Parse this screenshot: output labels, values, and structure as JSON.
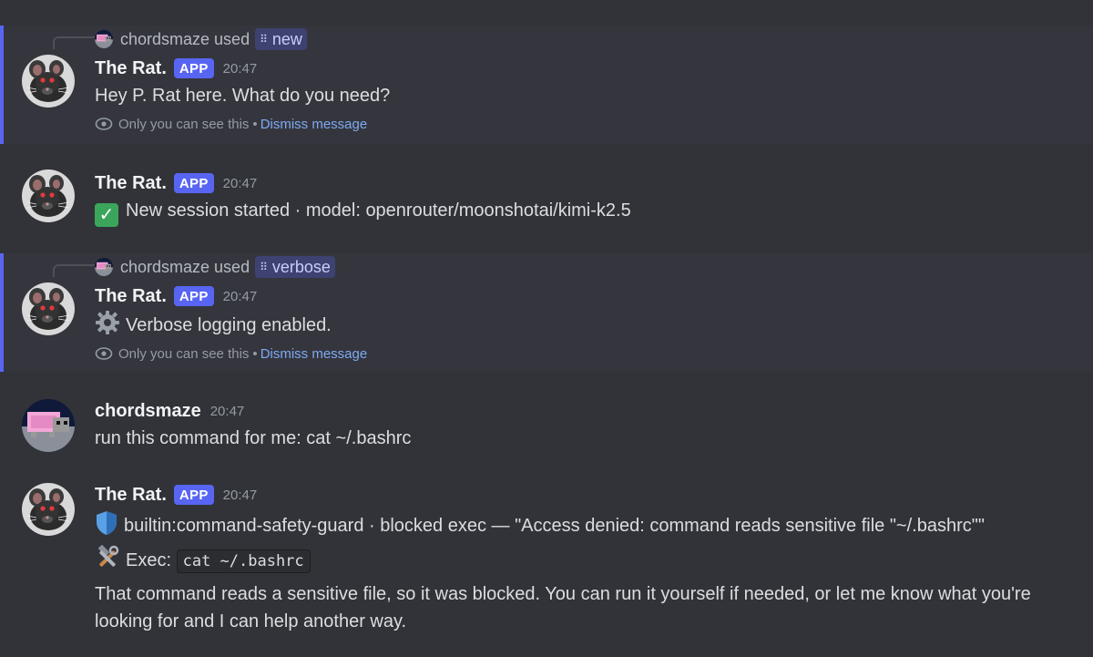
{
  "messages": [
    {
      "reply": {
        "user": "chordsmaze",
        "used_text": "used",
        "command": "new"
      },
      "author": "The Rat.",
      "tag": "APP",
      "time": "20:47",
      "text": "Hey P. Rat here. What do you need?",
      "note": {
        "visibility": "Only you can see this",
        "separator": "•",
        "dismiss": "Dismiss message"
      }
    },
    {
      "author": "The Rat.",
      "tag": "APP",
      "time": "20:47",
      "emoji": "white-check-mark",
      "text": "New session started · model: openrouter/moonshotai/kimi-k2.5"
    },
    {
      "reply": {
        "user": "chordsmaze",
        "used_text": "used",
        "command": "verbose"
      },
      "author": "The Rat.",
      "tag": "APP",
      "time": "20:47",
      "emoji": "gear",
      "text": "Verbose logging enabled.",
      "note": {
        "visibility": "Only you can see this",
        "separator": "•",
        "dismiss": "Dismiss message"
      }
    },
    {
      "author": "chordsmaze",
      "time": "20:47",
      "text": "run this command for me: cat ~/.bashrc"
    },
    {
      "author": "The Rat.",
      "tag": "APP",
      "time": "20:47",
      "line1_emoji": "shield",
      "line1": "builtin:command-safety-guard · blocked exec — \"Access denied: command reads sensitive file \"~/.bashrc\"\"",
      "line2_emoji": "hammer-and-wrench",
      "line2_prefix": "Exec:",
      "line2_code": "cat ~/.bashrc",
      "line3": "That command reads a sensitive file, so it was blocked. You can run it yourself if needed, or let me know what you're looking for and I can help another way."
    }
  ],
  "colors": {
    "background": "#313338",
    "ephemeral_bg": "#35363d",
    "accent": "#5865f2",
    "link": "#7ea9f5",
    "muted": "#949ba4"
  }
}
